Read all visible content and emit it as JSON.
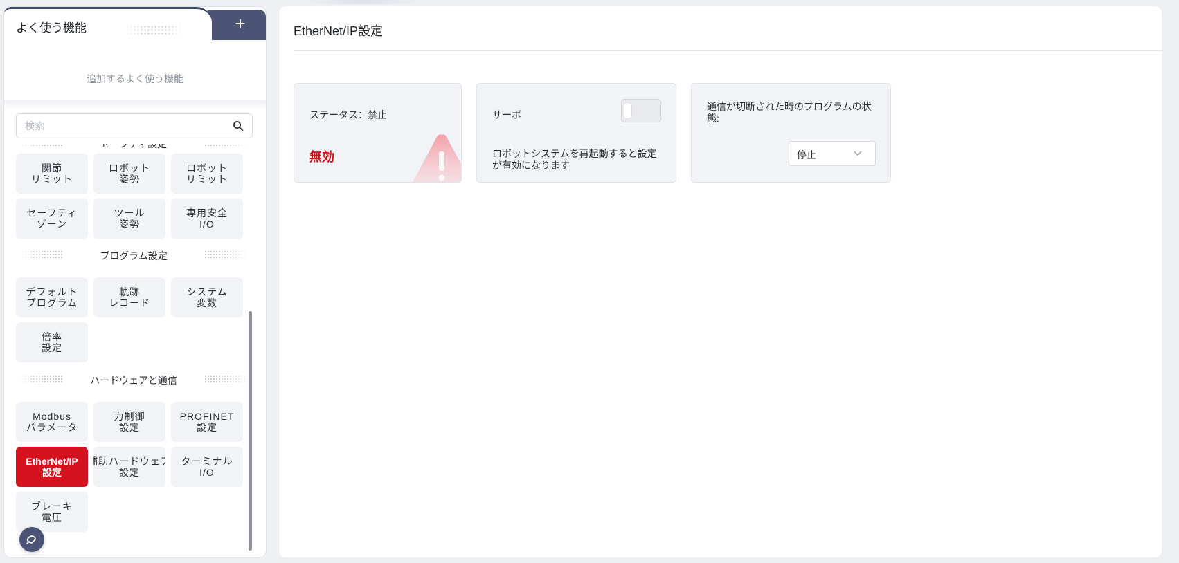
{
  "favorites": {
    "title": "よく使う機能",
    "add_label": "+",
    "placeholder": "追加するよく使う機能"
  },
  "search": {
    "placeholder": "検索",
    "value": ""
  },
  "menu": {
    "sections": [
      {
        "title": "セーフティ設定",
        "items": [
          {
            "label": "関節\nリミット"
          },
          {
            "label": "ロボット\n姿勢"
          },
          {
            "label": "ロボット\nリミット"
          },
          {
            "label": "セーフティ\nゾーン"
          },
          {
            "label": "ツール\n姿勢"
          },
          {
            "label": "専用安全\nI/O"
          }
        ]
      },
      {
        "title": "プログラム設定",
        "items": [
          {
            "label": "デフォルト\nプログラム"
          },
          {
            "label": "軌跡\nレコード"
          },
          {
            "label": "システム\n変数"
          },
          {
            "label": "倍率\n設定"
          }
        ]
      },
      {
        "title": "ハードウェアと通信",
        "items": [
          {
            "label": "Modbus\nパラメータ"
          },
          {
            "label": "力制御\n設定"
          },
          {
            "label": "PROFINET\n設定"
          },
          {
            "label": "EtherNet/IP\n設定"
          },
          {
            "label": "補助ハードウェア\n設定"
          },
          {
            "label": "ターミナル\nI/O"
          },
          {
            "label": "ブレーキ\n電圧"
          }
        ]
      }
    ]
  },
  "page": {
    "title": "EtherNet/IP設定",
    "status": {
      "label": "ステータス：禁止",
      "value": "無効"
    },
    "servo": {
      "label": "サーボ",
      "enabled": false,
      "note": "ロボットシステムを再起動すると設定が有効になります"
    },
    "comm": {
      "label": "通信が切断された時のプログラムの状態:",
      "selected": "停止"
    }
  },
  "colors": {
    "accent": "#d5131f",
    "nav_dark": "#4b5475",
    "card_bg": "#f2f3f6"
  }
}
